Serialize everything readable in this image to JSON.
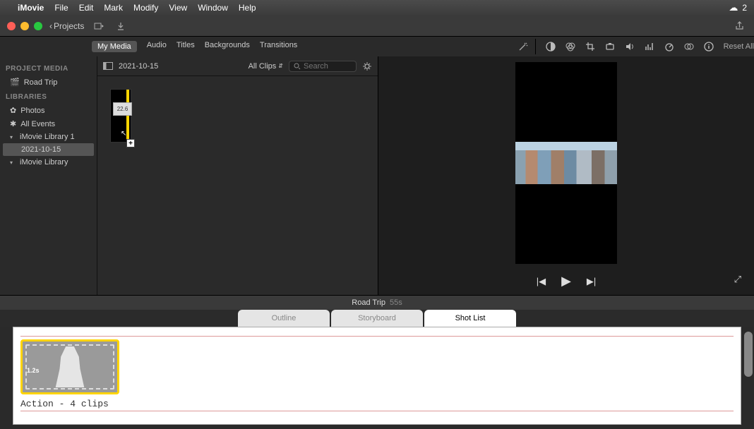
{
  "menubar": {
    "app": "iMovie",
    "items": [
      "File",
      "Edit",
      "Mark",
      "Modify",
      "View",
      "Window",
      "Help"
    ],
    "right_count": "2"
  },
  "toolbar": {
    "projects_label": "Projects"
  },
  "tabs": {
    "my_media": "My Media",
    "audio": "Audio",
    "titles": "Titles",
    "backgrounds": "Backgrounds",
    "transitions": "Transitions",
    "reset_all": "Reset All"
  },
  "sidebar": {
    "hdr_project": "PROJECT MEDIA",
    "road_trip": "Road Trip",
    "hdr_libraries": "LIBRARIES",
    "photos": "Photos",
    "all_events": "All Events",
    "lib1": "iMovie Library 1",
    "lib1_date": "2021-10-15",
    "lib2": "iMovie Library"
  },
  "browser": {
    "date": "2021-10-15",
    "all_clips": "All Clips",
    "search_placeholder": "Search",
    "clip_dur": "22.6"
  },
  "viewer": {
    "caption": ""
  },
  "project": {
    "title": "Road Trip",
    "duration": "55s"
  },
  "mode_tabs": {
    "outline": "Outline",
    "storyboard": "Storyboard",
    "shot_list": "Shot List"
  },
  "shotlist": {
    "clip_dur": "1.2s",
    "row_label": "Action - 4 clips"
  }
}
